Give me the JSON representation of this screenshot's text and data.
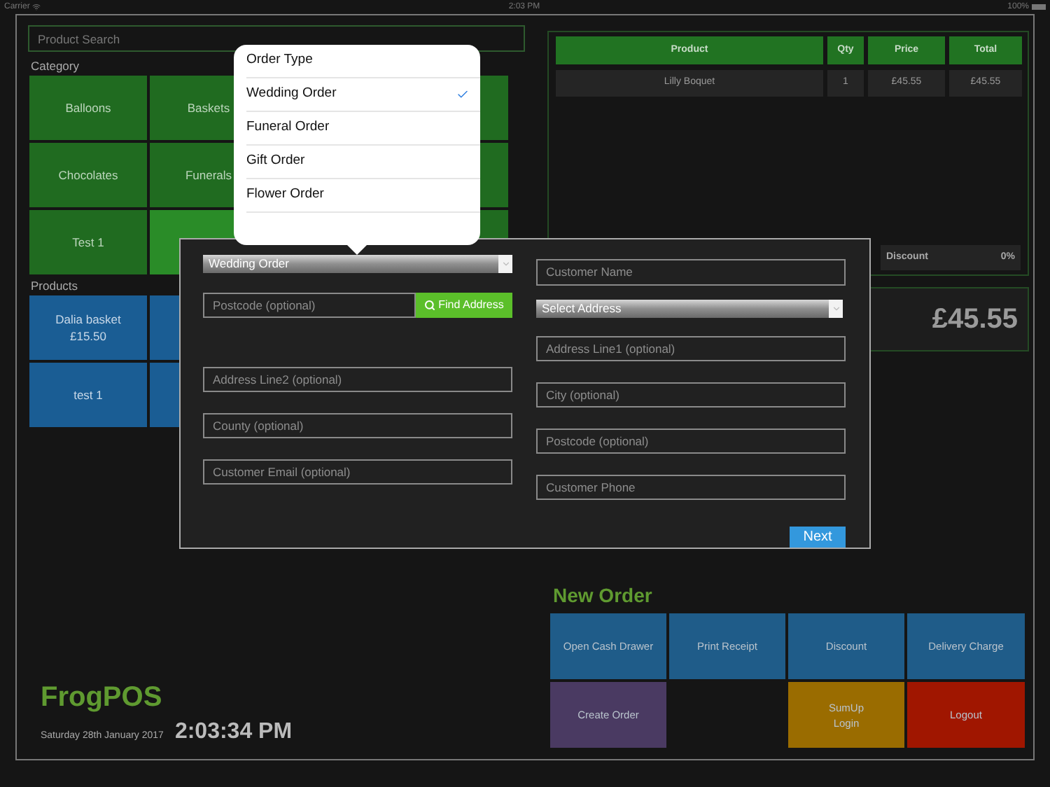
{
  "status_bar": {
    "carrier": "Carrier",
    "time": "2:03 PM",
    "battery": "100%"
  },
  "search": {
    "placeholder": "Product Search"
  },
  "category": {
    "title": "Category",
    "rows": [
      {
        "tiles": [
          {
            "label": "Balloons",
            "selected": false
          },
          {
            "label": "Baskets",
            "selected": false
          }
        ],
        "edge": {
          "selected": false
        }
      },
      {
        "tiles": [
          {
            "label": "Chocolates",
            "selected": false
          },
          {
            "label": "Funerals",
            "selected": false
          }
        ],
        "edge": {
          "selected": false
        }
      },
      {
        "tiles": [
          {
            "label": "Test 1",
            "selected": false
          },
          {
            "selected": true
          }
        ],
        "edge": {
          "selected": false
        }
      }
    ]
  },
  "products": {
    "title": "Products",
    "tiles": [
      {
        "name": "Dalia basket",
        "price": "£15.50"
      },
      {
        "name": "test 1"
      }
    ]
  },
  "order_table": {
    "columns": [
      "Product",
      "Qty",
      "Price",
      "Total"
    ],
    "rows": [
      [
        "Lilly Boquet",
        "1",
        "£45.55",
        "£45.55"
      ]
    ],
    "discount": {
      "label": "Discount",
      "value": "0%"
    },
    "total": "£45.55"
  },
  "brand": {
    "name": "FrogPOS",
    "date": "Saturday 28th January 2017",
    "time": "2:03:34 PM"
  },
  "new_order": {
    "title": "New Order",
    "buttons": [
      {
        "kind": "button",
        "label": "Open Cash Drawer",
        "color": "#1f5c89"
      },
      {
        "kind": "button",
        "label": "Print Receipt",
        "color": "#1f5c89"
      },
      {
        "kind": "button",
        "label": "Discount",
        "color": "#1f5c89"
      },
      {
        "kind": "button",
        "label": "Delivery Charge",
        "color": "#1f5c89"
      },
      {
        "kind": "button",
        "label": "Create Order",
        "color": "#4a3a62"
      },
      {
        "kind": "empty"
      },
      {
        "kind": "button",
        "label": "SumUp\nLogin",
        "color": "#9a6c00"
      },
      {
        "kind": "button",
        "label": "Logout",
        "color": "#a01600"
      }
    ]
  },
  "order_dialog": {
    "order_type": "Wedding Order",
    "postcode_search": {
      "placeholder": "Postcode (optional)"
    },
    "find_button": "Find Address",
    "left_fields": [
      {
        "placeholder": "Address Line2 (optional)"
      },
      {
        "placeholder": "County (optional)"
      },
      {
        "placeholder": "Customer Email (optional)"
      }
    ],
    "customer_name": {
      "placeholder": "Customer Name"
    },
    "address_select": "Select Address",
    "right_fields": [
      {
        "placeholder": "Address Line1 (optional)"
      },
      {
        "placeholder": "City (optional)"
      },
      {
        "placeholder": "Postcode (optional)"
      },
      {
        "placeholder": "Customer Phone"
      }
    ],
    "next_button": "Next"
  },
  "order_type_popover": {
    "title": "Order Type",
    "options": [
      {
        "label": "Wedding Order",
        "selected": true
      },
      {
        "label": "Funeral Order",
        "selected": false
      },
      {
        "label": "Gift Order",
        "selected": false
      },
      {
        "label": "Flower Order",
        "selected": false
      }
    ]
  }
}
